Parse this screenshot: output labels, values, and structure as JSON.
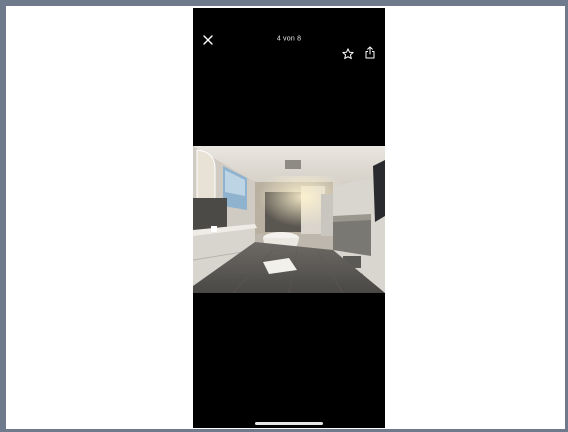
{
  "viewer": {
    "counter": "4 von 8"
  },
  "icons": {
    "close": "close-icon",
    "favorite": "star-icon",
    "share": "share-icon"
  },
  "colors": {
    "viewer_background": "#000000",
    "window_border": "#6f7a8c",
    "icon_color": "#ffffff"
  }
}
